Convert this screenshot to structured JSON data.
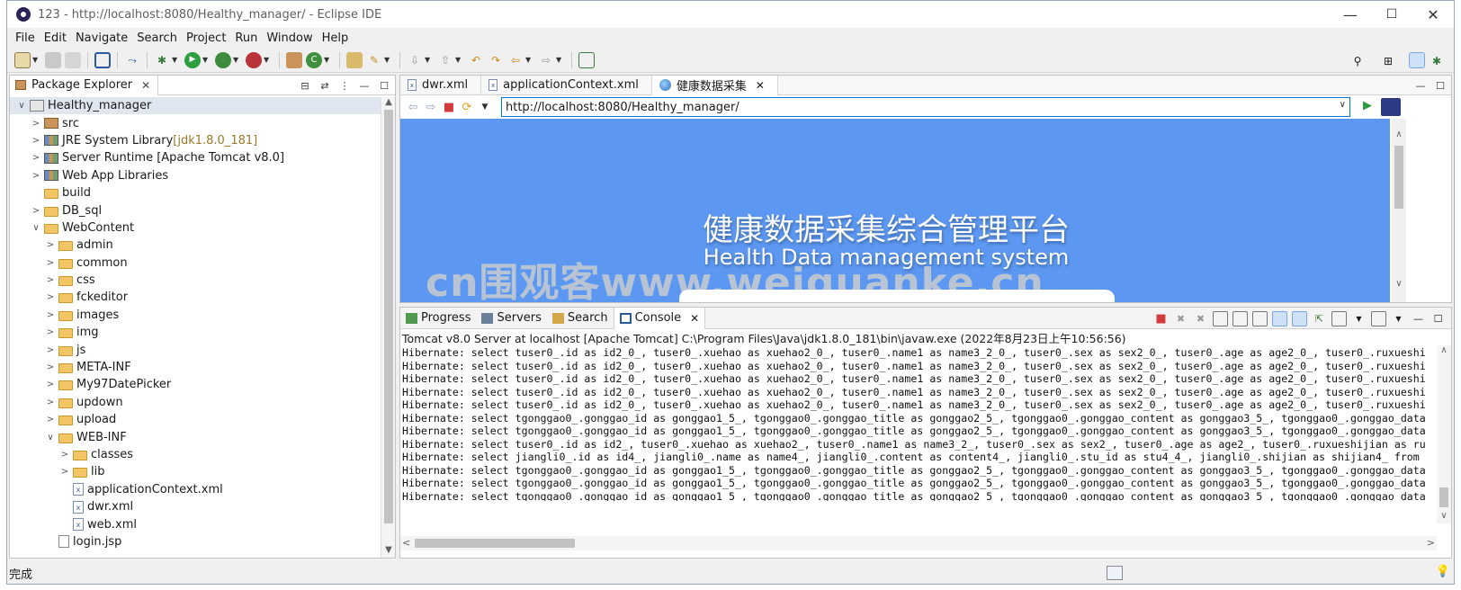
{
  "window": {
    "title": "123 - http://localhost:8080/Healthy_manager/ - Eclipse IDE",
    "minimize": "—",
    "maximize": "☐",
    "close": "✕"
  },
  "menu": [
    "File",
    "Edit",
    "Navigate",
    "Search",
    "Project",
    "Run",
    "Window",
    "Help"
  ],
  "package_explorer": {
    "tab_label": "Package Explorer",
    "tree": [
      {
        "label": "Healthy_manager",
        "suffix": "",
        "indent": 0,
        "twisty": "∨",
        "icon": "project-icon",
        "selected": true
      },
      {
        "label": "src",
        "suffix": "",
        "indent": 1,
        "twisty": ">",
        "icon": "package-icon"
      },
      {
        "label": "JRE System Library",
        "suffix": " [jdk1.8.0_181]",
        "indent": 1,
        "twisty": ">",
        "icon": "library-icon"
      },
      {
        "label": "Server Runtime [Apache Tomcat v8.0]",
        "suffix": "",
        "indent": 1,
        "twisty": ">",
        "icon": "library-icon"
      },
      {
        "label": "Web App Libraries",
        "suffix": "",
        "indent": 1,
        "twisty": ">",
        "icon": "library-icon"
      },
      {
        "label": "build",
        "suffix": "",
        "indent": 1,
        "twisty": "",
        "icon": "folder-icon"
      },
      {
        "label": "DB_sql",
        "suffix": "",
        "indent": 1,
        "twisty": ">",
        "icon": "folder-icon"
      },
      {
        "label": "WebContent",
        "suffix": "",
        "indent": 1,
        "twisty": "∨",
        "icon": "web-folder-icon"
      },
      {
        "label": "admin",
        "suffix": "",
        "indent": 2,
        "twisty": ">",
        "icon": "folder-icon"
      },
      {
        "label": "common",
        "suffix": "",
        "indent": 2,
        "twisty": ">",
        "icon": "folder-icon"
      },
      {
        "label": "css",
        "suffix": "",
        "indent": 2,
        "twisty": ">",
        "icon": "folder-icon"
      },
      {
        "label": "fckeditor",
        "suffix": "",
        "indent": 2,
        "twisty": ">",
        "icon": "folder-icon"
      },
      {
        "label": "images",
        "suffix": "",
        "indent": 2,
        "twisty": ">",
        "icon": "folder-icon"
      },
      {
        "label": "img",
        "suffix": "",
        "indent": 2,
        "twisty": ">",
        "icon": "folder-icon"
      },
      {
        "label": "js",
        "suffix": "",
        "indent": 2,
        "twisty": ">",
        "icon": "folder-icon"
      },
      {
        "label": "META-INF",
        "suffix": "",
        "indent": 2,
        "twisty": ">",
        "icon": "folder-icon"
      },
      {
        "label": "My97DatePicker",
        "suffix": "",
        "indent": 2,
        "twisty": ">",
        "icon": "folder-icon"
      },
      {
        "label": "updown",
        "suffix": "",
        "indent": 2,
        "twisty": ">",
        "icon": "folder-icon"
      },
      {
        "label": "upload",
        "suffix": "",
        "indent": 2,
        "twisty": ">",
        "icon": "folder-icon"
      },
      {
        "label": "WEB-INF",
        "suffix": "",
        "indent": 2,
        "twisty": "∨",
        "icon": "web-folder-icon"
      },
      {
        "label": "classes",
        "suffix": "",
        "indent": 3,
        "twisty": ">",
        "icon": "folder-icon"
      },
      {
        "label": "lib",
        "suffix": "",
        "indent": 3,
        "twisty": ">",
        "icon": "folder-icon"
      },
      {
        "label": "applicationContext.xml",
        "suffix": "",
        "indent": 3,
        "twisty": "",
        "icon": "xml-file-icon"
      },
      {
        "label": "dwr.xml",
        "suffix": "",
        "indent": 3,
        "twisty": "",
        "icon": "xml-file-icon"
      },
      {
        "label": "web.xml",
        "suffix": "",
        "indent": 3,
        "twisty": "",
        "icon": "xml-file-icon"
      },
      {
        "label": "login.jsp",
        "suffix": "",
        "indent": 2,
        "twisty": "",
        "icon": "jsp-file-icon"
      }
    ]
  },
  "editor": {
    "tabs": [
      {
        "label": "dwr.xml",
        "active": false
      },
      {
        "label": "applicationContext.xml",
        "active": false
      },
      {
        "label": "健康数据采集",
        "active": true
      }
    ],
    "url": "http://localhost:8080/Healthy_manager/",
    "page": {
      "title_cn": "健康数据采集综合管理平台",
      "title_en": "Health Data management system",
      "watermark": "cn围观客www.weiguanke.cn"
    }
  },
  "console": {
    "tabs": [
      {
        "label": "Progress",
        "active": false
      },
      {
        "label": "Servers",
        "active": false
      },
      {
        "label": "Search",
        "active": false
      },
      {
        "label": "Console",
        "active": true
      }
    ],
    "header": "Tomcat v8.0 Server at localhost [Apache Tomcat] C:\\Program Files\\Java\\jdk1.8.0_181\\bin\\javaw.exe  (2022年8月23日上午10:56:56)",
    "lines": [
      "Hibernate: select tuser0_.id as id2_0_, tuser0_.xuehao as xuehao2_0_, tuser0_.name1 as name3_2_0_, tuser0_.sex as sex2_0_, tuser0_.age as age2_0_, tuser0_.ruxueshi",
      "Hibernate: select tuser0_.id as id2_0_, tuser0_.xuehao as xuehao2_0_, tuser0_.name1 as name3_2_0_, tuser0_.sex as sex2_0_, tuser0_.age as age2_0_, tuser0_.ruxueshi",
      "Hibernate: select tuser0_.id as id2_0_, tuser0_.xuehao as xuehao2_0_, tuser0_.name1 as name3_2_0_, tuser0_.sex as sex2_0_, tuser0_.age as age2_0_, tuser0_.ruxueshi",
      "Hibernate: select tuser0_.id as id2_0_, tuser0_.xuehao as xuehao2_0_, tuser0_.name1 as name3_2_0_, tuser0_.sex as sex2_0_, tuser0_.age as age2_0_, tuser0_.ruxueshi",
      "Hibernate: select tuser0_.id as id2_0_, tuser0_.xuehao as xuehao2_0_, tuser0_.name1 as name3_2_0_, tuser0_.sex as sex2_0_, tuser0_.age as age2_0_, tuser0_.ruxueshi",
      "Hibernate: select tgonggao0_.gonggao_id as gonggao1_5_, tgonggao0_.gonggao_title as gonggao2_5_, tgonggao0_.gonggao_content as gonggao3_5_, tgonggao0_.gonggao_data",
      "Hibernate: select tgonggao0_.gonggao_id as gonggao1_5_, tgonggao0_.gonggao_title as gonggao2_5_, tgonggao0_.gonggao_content as gonggao3_5_, tgonggao0_.gonggao_data",
      "Hibernate: select tuser0_.id as id2_, tuser0_.xuehao as xuehao2_, tuser0_.name1 as name3_2_, tuser0_.sex as sex2_, tuser0_.age as age2_, tuser0_.ruxueshijian as ru",
      "Hibernate: select jiangli0_.id as id4_, jiangli0_.name as name4_, jiangli0_.content as content4_, jiangli0_.stu_id as stu4_4_, jiangli0_.shijian as shijian4_ from",
      "Hibernate: select tgonggao0_.gonggao_id as gonggao1_5_, tgonggao0_.gonggao_title as gonggao2_5_, tgonggao0_.gonggao_content as gonggao3_5_, tgonggao0_.gonggao_data",
      "Hibernate: select tgonggao0_.gonggao_id as gonggao1_5_, tgonggao0_.gonggao_title as gonggao2_5_, tgonggao0_.gonggao_content as gonggao3_5_, tgonggao0_.gonggao_data",
      "Hibernate: select tgonggao0_.gonggao_id as gonggao1_5_, tgonggao0_.gonggao_title as gonggao2_5_, tgonggao0_.gonggao_content as gonggao3_5_, tgonggao0_.gonggao_data"
    ]
  },
  "status": {
    "text": "完成"
  }
}
